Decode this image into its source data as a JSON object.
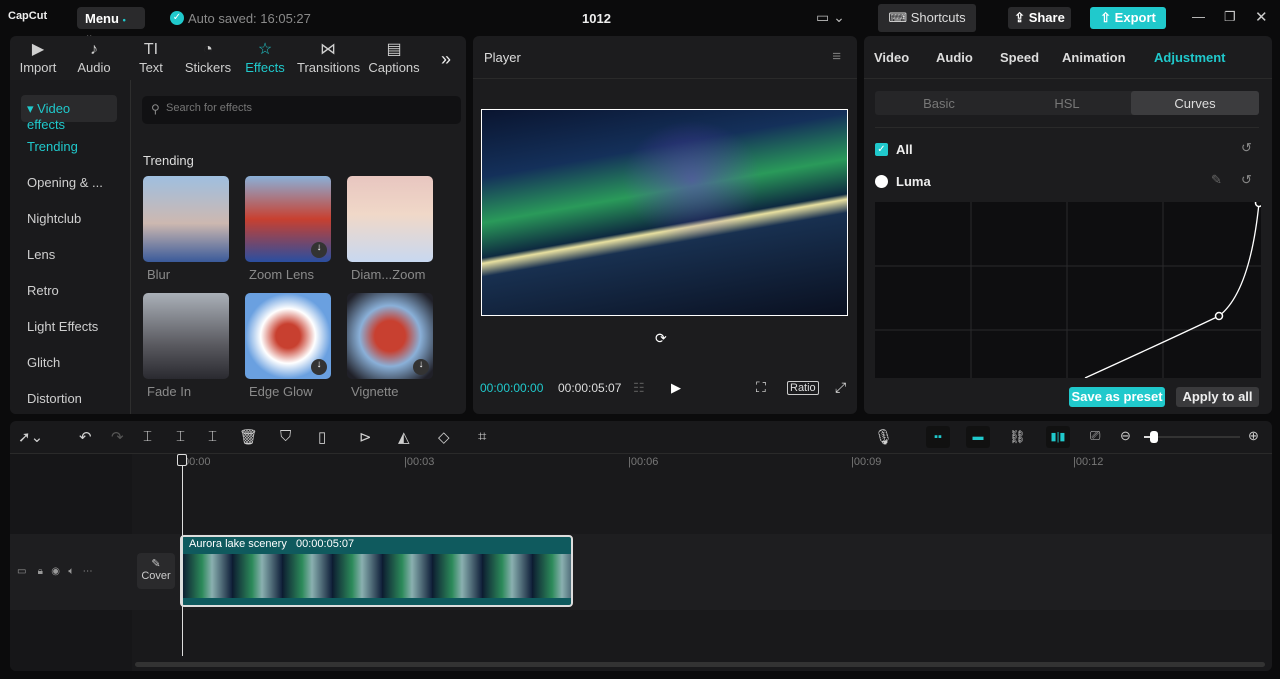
{
  "app": {
    "logo": "CapCut",
    "menu": "Menu",
    "autosave": "Auto saved: 16:05:27",
    "title": "1012",
    "shortcuts": "Shortcuts",
    "share": "Share",
    "export": "Export"
  },
  "media_tabs": [
    {
      "label": "Import",
      "icon": "▶"
    },
    {
      "label": "Audio",
      "icon": "♪"
    },
    {
      "label": "Text",
      "icon": "TI"
    },
    {
      "label": "Stickers",
      "icon": "◔"
    },
    {
      "label": "Effects",
      "icon": "☆"
    },
    {
      "label": "Transitions",
      "icon": "⋈"
    },
    {
      "label": "Captions",
      "icon": "▤"
    }
  ],
  "effects": {
    "category": "Video effects",
    "sidebar": [
      "Trending",
      "Opening & ...",
      "Nightclub",
      "Lens",
      "Retro",
      "Light Effects",
      "Glitch",
      "Distortion"
    ],
    "search_placeholder": "Search for effects",
    "section": "Trending",
    "items": [
      "Blur",
      "Zoom Lens",
      "Diam...Zoom",
      "Fade In",
      "Edge Glow",
      "Vignette"
    ]
  },
  "player": {
    "title": "Player",
    "current_time": "00:00:00:00",
    "duration": "00:00:05:07",
    "ratio": "Ratio"
  },
  "inspector": {
    "tabs": [
      "Video",
      "Audio",
      "Speed",
      "Animation",
      "Adjustment"
    ],
    "subtabs": [
      "Basic",
      "HSL",
      "Curves"
    ],
    "channels": [
      "All",
      "Luma"
    ],
    "save_preset": "Save as preset",
    "apply_all": "Apply to all"
  },
  "timeline": {
    "ticks": [
      "00:00",
      "00:03",
      "00:06",
      "00:09",
      "00:12"
    ],
    "clip_name": "Aurora lake scenery",
    "clip_duration": "00:00:05:07",
    "cover": "Cover",
    "zoom_level": 0.1
  },
  "colors": {
    "accent": "#20c9cc"
  }
}
